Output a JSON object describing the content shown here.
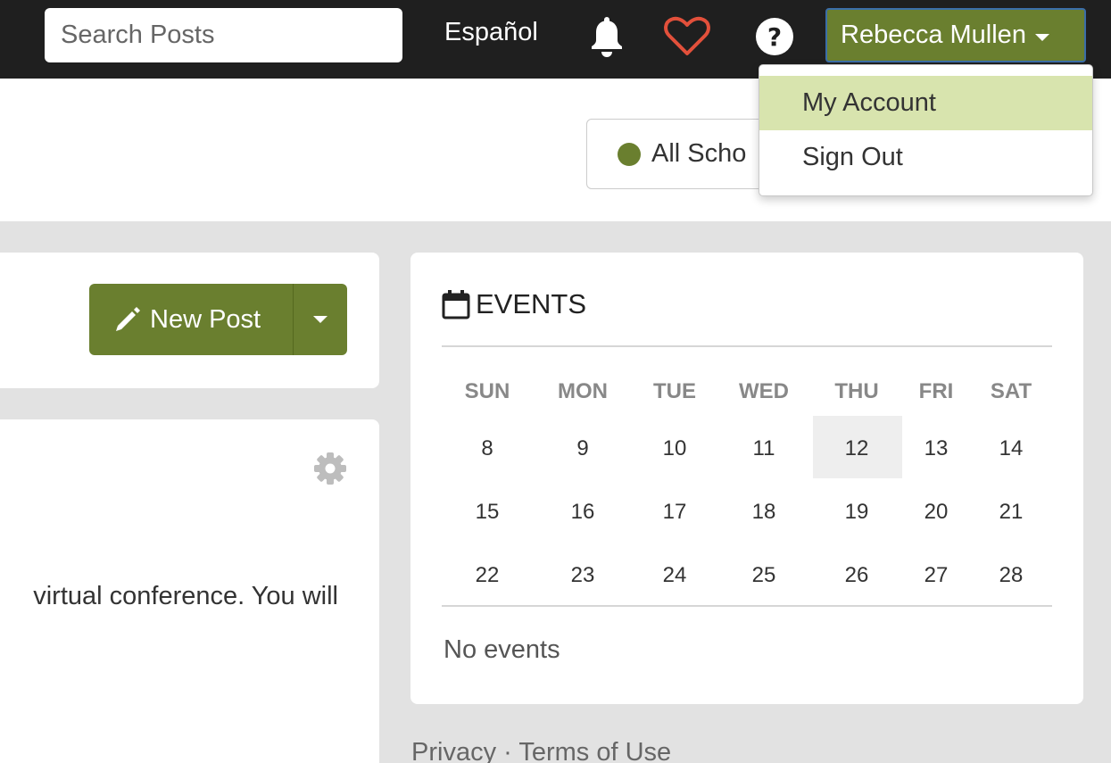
{
  "header": {
    "search_placeholder": "Search Posts",
    "language_link": "Español",
    "user_name": "Rebecca Mullen",
    "accent_color": "#6a7f2f"
  },
  "user_menu": {
    "items": [
      "My Account",
      "Sign Out"
    ],
    "highlighted": "My Account"
  },
  "school_filter": {
    "label": "All Scho"
  },
  "posts": {
    "new_post_label": "New Post",
    "post_excerpt": "virtual conference. You will"
  },
  "events": {
    "title": "EVENTS",
    "weekdays": [
      "SUN",
      "MON",
      "TUE",
      "WED",
      "THU",
      "FRI",
      "SAT"
    ],
    "weeks": [
      [
        "8",
        "9",
        "10",
        "11",
        "12",
        "13",
        "14"
      ],
      [
        "15",
        "16",
        "17",
        "18",
        "19",
        "20",
        "21"
      ],
      [
        "22",
        "23",
        "24",
        "25",
        "26",
        "27",
        "28"
      ]
    ],
    "today": "12",
    "empty_text": "No events"
  },
  "footer": {
    "privacy": "Privacy",
    "separator": "·",
    "terms": "Terms of Use"
  }
}
